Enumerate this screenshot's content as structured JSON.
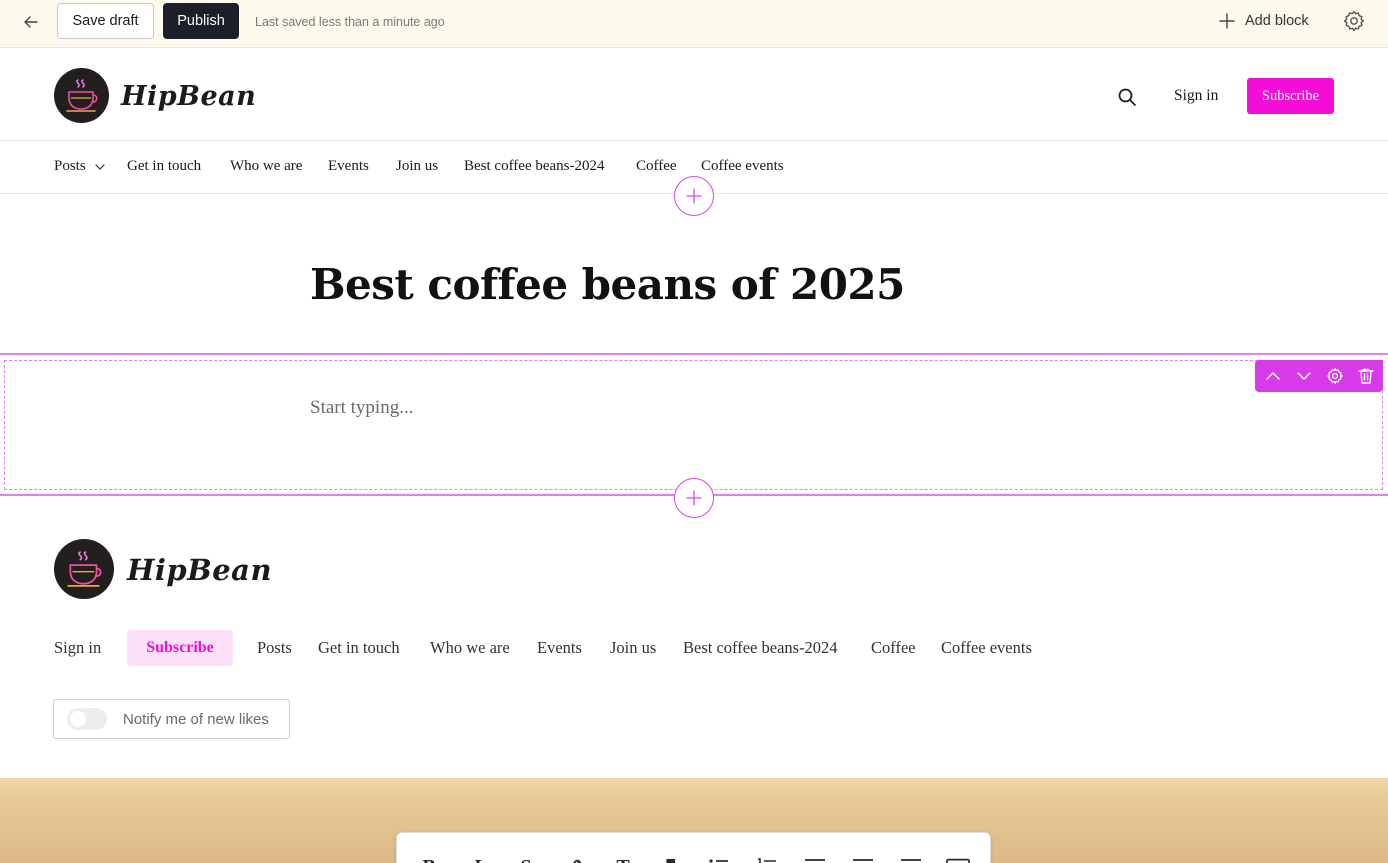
{
  "editor": {
    "save_draft_label": "Save draft",
    "publish_label": "Publish",
    "saved_status": "Last saved less than a minute ago",
    "add_block_label": "Add block"
  },
  "site": {
    "logo_text": "HipBean",
    "sign_in_label": "Sign in",
    "subscribe_label": "Subscribe",
    "accent_color": "#f30ed7"
  },
  "nav": {
    "items": [
      {
        "label": "Posts"
      },
      {
        "label": "Get in touch"
      },
      {
        "label": "Who we are"
      },
      {
        "label": "Events"
      },
      {
        "label": "Join us"
      },
      {
        "label": "Best coffee beans-2024"
      },
      {
        "label": "Coffee"
      },
      {
        "label": "Coffee events"
      }
    ]
  },
  "post": {
    "title": "Best coffee beans of 2025",
    "body_placeholder": "Start typing..."
  },
  "footer": {
    "logo_text": "HipBean",
    "sign_in_label": "Sign in",
    "subscribe_label": "Subscribe",
    "links": [
      {
        "label": "Posts"
      },
      {
        "label": "Get in touch"
      },
      {
        "label": "Who we are"
      },
      {
        "label": "Events"
      },
      {
        "label": "Join us"
      },
      {
        "label": "Best coffee beans-2024"
      },
      {
        "label": "Coffee"
      },
      {
        "label": "Coffee events"
      }
    ],
    "notify_label": "Notify me of new likes",
    "notify_enabled": false
  },
  "format_toolbar": {
    "buttons": [
      "bold-icon",
      "italic-icon",
      "strikethrough-icon",
      "link-icon",
      "text-style-icon",
      "quote-icon",
      "bulleted-list-icon",
      "numbered-list-icon",
      "align-left-icon",
      "align-center-icon",
      "align-right-icon",
      "image-icon"
    ]
  }
}
